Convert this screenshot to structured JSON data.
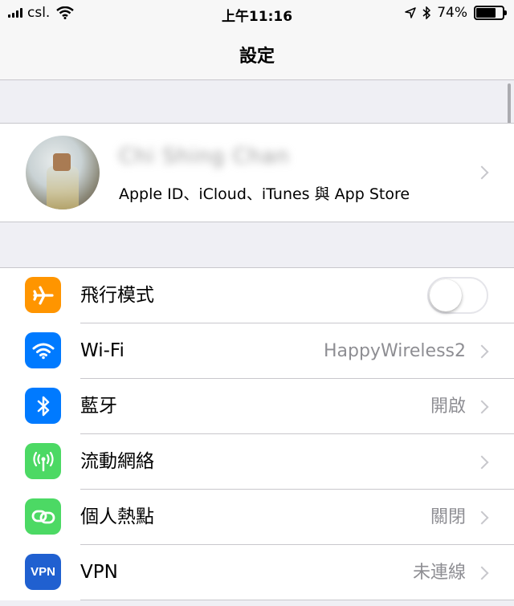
{
  "status_bar": {
    "carrier": "csl.",
    "time": "上午11:16",
    "battery_percent": "74%",
    "battery_level": 0.74
  },
  "nav": {
    "title": "設定"
  },
  "profile": {
    "name": "Chi Shing Chan",
    "subtitle": "Apple ID、iCloud、iTunes 與 App Store"
  },
  "settings": [
    {
      "label": "飛行模式",
      "icon": "airplane-icon",
      "icon_color": "#ff9500",
      "toggle": false
    },
    {
      "label": "Wi-Fi",
      "value": "HappyWireless2",
      "icon": "wifi-icon",
      "icon_color": "#007aff"
    },
    {
      "label": "藍牙",
      "value": "開啟",
      "icon": "bluetooth-icon",
      "icon_color": "#007aff"
    },
    {
      "label": "流動網絡",
      "value": "",
      "icon": "antenna-icon",
      "icon_color": "#4cd964"
    },
    {
      "label": "個人熱點",
      "value": "關閉",
      "icon": "hotspot-icon",
      "icon_color": "#4cd964"
    },
    {
      "label": "VPN",
      "value": "未連線",
      "icon": "vpn-icon",
      "icon_text": "VPN",
      "icon_color": "#2060d0"
    }
  ]
}
